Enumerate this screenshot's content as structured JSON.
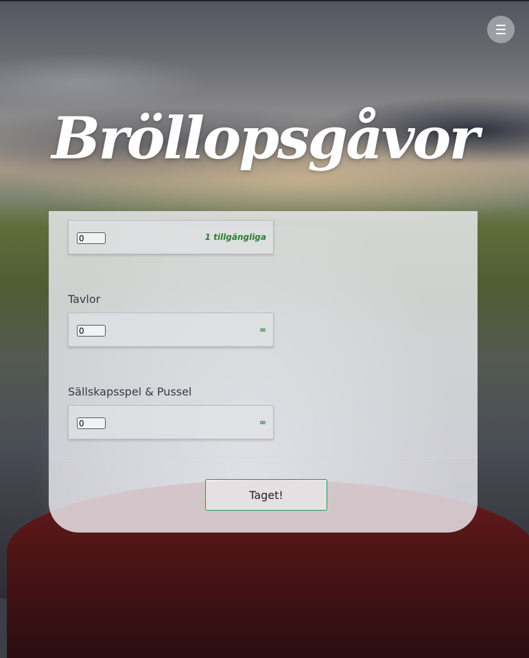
{
  "header": {
    "title": "Bröllopsgåvor",
    "menu_icon": "hamburger-menu-icon"
  },
  "gifts": [
    {
      "label": "",
      "quantity": "0",
      "availability": "1 tillgängliga"
    },
    {
      "label": "Tavlor",
      "quantity": "0",
      "availability": "∞"
    },
    {
      "label": "Sällskapsspel & Pussel",
      "quantity": "0",
      "availability": "∞"
    }
  ],
  "form": {
    "submit_label": "Taget!"
  },
  "colors": {
    "availability": "#2e7d32",
    "submit_border": "#1f9d55"
  }
}
